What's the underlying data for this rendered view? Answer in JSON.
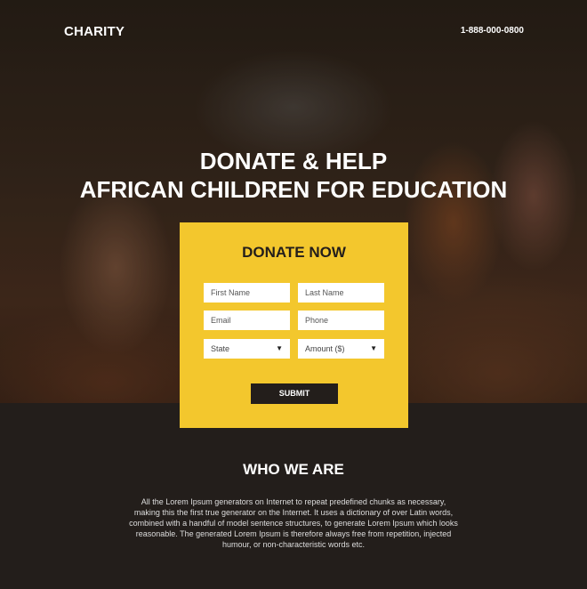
{
  "brand": {
    "name": "CHARITY"
  },
  "header": {
    "phone": "1-888-000-0800"
  },
  "hero": {
    "headline_line1": "DONATE & HELP",
    "headline_line2": "AFRICAN CHILDREN FOR EDUCATION"
  },
  "form": {
    "title": "DONATE NOW",
    "first_name_placeholder": "First Name",
    "last_name_placeholder": "Last Name",
    "email_placeholder": "Email",
    "phone_placeholder": "Phone",
    "state_selected": "State",
    "amount_selected": "Amount ($)",
    "submit_label": "SUBMIT"
  },
  "about": {
    "title": "WHO WE ARE",
    "text": "All the Lorem Ipsum generators on Internet to repeat predefined chunks as necessary, making this the first true generator on the Internet. It uses a dictionary of over Latin words, combined with a handful of model sentence structures, to generate Lorem Ipsum which looks reasonable. The generated Lorem Ipsum is therefore always free from repetition, injected humour, or non-characteristic words etc."
  },
  "colors": {
    "accent": "#f3c72d",
    "dark": "#231e1b"
  }
}
